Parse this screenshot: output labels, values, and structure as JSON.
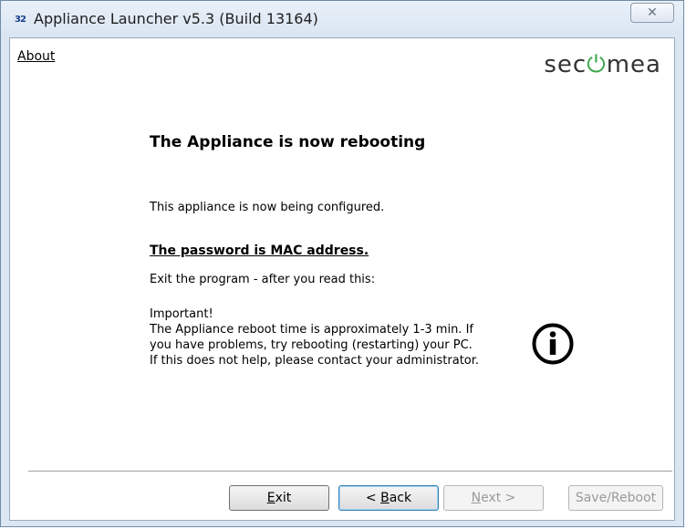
{
  "window": {
    "title": "Appliance Launcher v5.3 (Build 13164)",
    "app_icon_text": "32",
    "close_glyph": "✕"
  },
  "menu": {
    "about_label": "About"
  },
  "brand": {
    "logo_prefix": "sec",
    "logo_power_glyph": "ɷ",
    "logo_suffix": "mea",
    "accent_color": "#3aa54b"
  },
  "content": {
    "heading": "The Appliance is now rebooting",
    "configured_line": "This appliance is now being configured.",
    "password_line": "The password is MAC address.",
    "exit_line": "Exit the program - after you read this:",
    "important_title": "Important!",
    "important_line1": "The Appliance reboot time is approximately 1-3 min. If",
    "important_line2": "you have problems, try rebooting (restarting) your PC.",
    "important_line3": "If this does not help, please contact your administrator.",
    "info_icon": "info-icon"
  },
  "buttons": {
    "exit_accel": "E",
    "exit_rest": "xit",
    "back_prefix": "< ",
    "back_accel": "B",
    "back_rest": "ack",
    "next_accel": "N",
    "next_rest": "ext >",
    "save_reboot": "Save/Reboot"
  }
}
